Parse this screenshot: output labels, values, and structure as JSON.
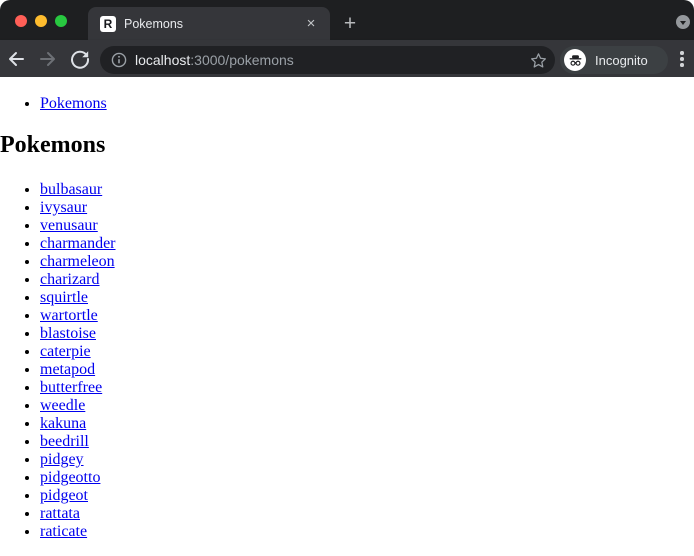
{
  "window": {
    "tab": {
      "title": "Pokemons",
      "favicon_glyph": "R"
    },
    "tab_close_glyph": "×",
    "new_tab_glyph": "+"
  },
  "toolbar": {
    "url": {
      "host": "localhost",
      "rest": ":3000/pokemons"
    },
    "incognito_label": "Incognito"
  },
  "page": {
    "nav_links": [
      "Pokemons"
    ],
    "heading": "Pokemons",
    "pokemons": [
      "bulbasaur",
      "ivysaur",
      "venusaur",
      "charmander",
      "charmeleon",
      "charizard",
      "squirtle",
      "wartortle",
      "blastoise",
      "caterpie",
      "metapod",
      "butterfree",
      "weedle",
      "kakuna",
      "beedrill",
      "pidgey",
      "pidgeotto",
      "pidgeot",
      "rattata",
      "raticate"
    ]
  },
  "colors": {
    "frame": "#1e1f21",
    "toolbar": "#35363a",
    "omnibox": "#202124",
    "link_blue": "#0000EE",
    "traffic_close": "#ff5f57",
    "traffic_minimize": "#febc2e",
    "traffic_zoom": "#28c840"
  }
}
